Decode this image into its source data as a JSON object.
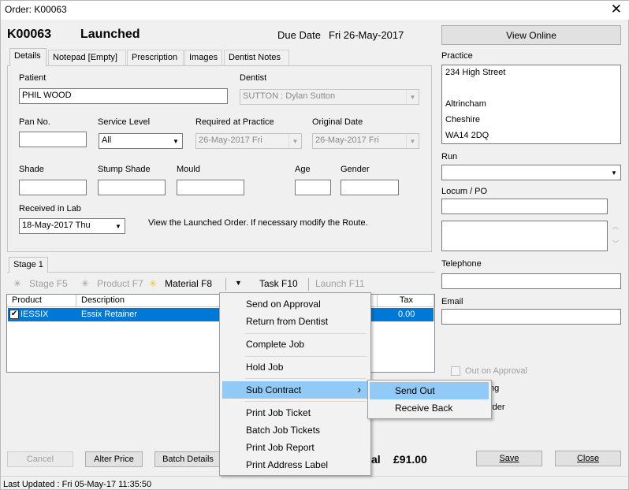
{
  "window": {
    "title": "Order: K00063",
    "close_glyph": "✕"
  },
  "header": {
    "order_no": "K00063",
    "status": "Launched",
    "due_label": "Due Date",
    "due_value": "Fri 26-May-2017",
    "view_online": "View Online"
  },
  "tabs": [
    {
      "label": "Details",
      "active": true
    },
    {
      "label": "Notepad [Empty]"
    },
    {
      "label": "Prescription"
    },
    {
      "label": "Images"
    },
    {
      "label": "Dentist Notes"
    }
  ],
  "details": {
    "patient_label": "Patient",
    "patient_value": "PHIL WOOD",
    "dentist_label": "Dentist",
    "dentist_value": "SUTTON : Dylan Sutton",
    "pan_label": "Pan No.",
    "pan_value": "",
    "service_label": "Service Level",
    "service_value": "All",
    "required_label": "Required at Practice",
    "required_value": "26-May-2017  Fri",
    "original_label": "Original Date",
    "original_value": "26-May-2017  Fri",
    "shade_label": "Shade",
    "stump_label": "Stump Shade",
    "mould_label": "Mould",
    "age_label": "Age",
    "gender_label": "Gender",
    "received_label": "Received in Lab",
    "received_value": "18-May-2017  Thu",
    "info_text": "View the Launched Order. If necessary modify the Route."
  },
  "right": {
    "practice_label": "Practice",
    "practice_lines": [
      "234 High Street",
      "",
      "Altrincham",
      "Cheshire",
      "WA14 2DQ"
    ],
    "run_label": "Run",
    "locum_label": "Locum / PO",
    "telephone_label": "Telephone",
    "email_label": "Email",
    "out_on_approval": "Out on Approval",
    "partial_1": "ng",
    "partial_2": "rder"
  },
  "stage": {
    "tab_label": "Stage 1",
    "toolbar": {
      "stage": "Stage F5",
      "product": "Product F7",
      "material": "Material F8",
      "task": "Task F10",
      "launch": "Launch F11"
    },
    "columns": {
      "product": "Product",
      "description": "Description",
      "tax": "Tax"
    },
    "rows": [
      {
        "product": "IESSIX",
        "description": "Essix Retainer",
        "tax": "0.00"
      }
    ]
  },
  "context_menu": {
    "items": [
      "Send on Approval",
      "Return from Dentist",
      "Complete Job",
      "Hold Job",
      "Sub Contract",
      "Print Job Ticket",
      "Batch Job Tickets",
      "Print Job Report",
      "Print Address Label"
    ],
    "submenu_arrow": "›"
  },
  "submenu": {
    "items": [
      "Send Out",
      "Receive Back"
    ]
  },
  "footer": {
    "cancel": "Cancel",
    "alter_price": "Alter Price",
    "batch_details": "Batch Details",
    "total_partial": "al",
    "total_value": "£91.00",
    "save": "Save",
    "close": "Close",
    "last_updated": "Last Updated : Fri 05-May-17 11:35:50"
  }
}
